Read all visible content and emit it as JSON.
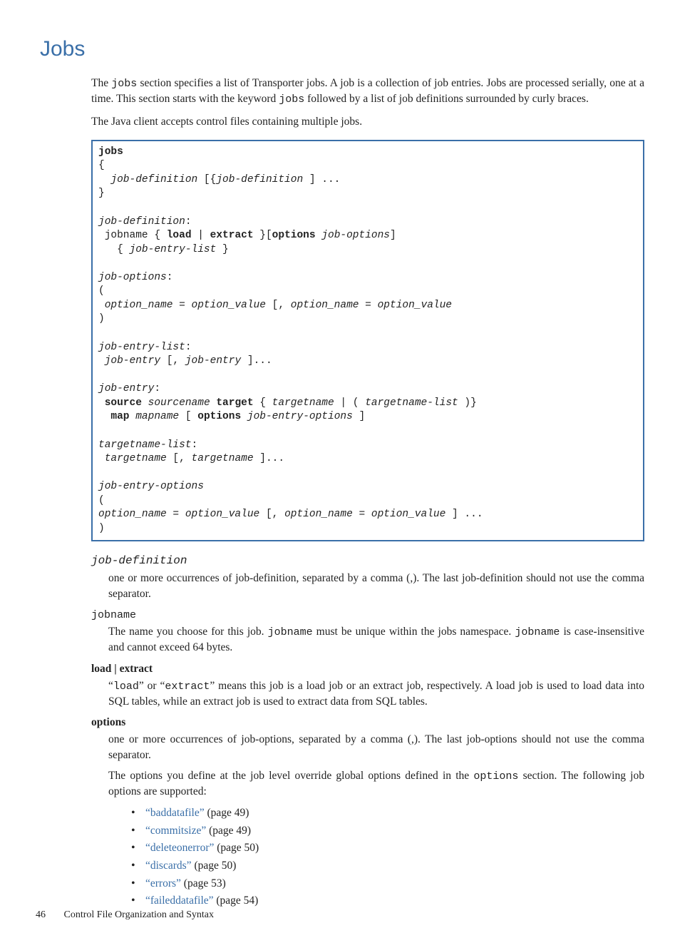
{
  "heading": "Jobs",
  "intro": {
    "p1a": "The ",
    "p1_code1": "jobs",
    "p1b": " section specifies a list of Transporter jobs. A job is a collection of job entries. Jobs are processed serially, one at a time. This section starts with the keyword ",
    "p1_code2": "jobs",
    "p1c": " followed by a list of job definitions surrounded by curly braces.",
    "p2": "The Java client accepts control files containing multiple jobs."
  },
  "syntax": {
    "l1": "jobs",
    "l2": "{",
    "l3a": "  ",
    "l3b": "job-definition",
    "l3c": " [{",
    "l3d": "job-definition",
    "l3e": " ] ...",
    "l4": "}",
    "blank1": " ",
    "l5": "job-definition",
    "l5b": ":",
    "l6a": " jobname { ",
    "l6b": "load",
    "l6c": " | ",
    "l6d": "extract",
    "l6e": " }[",
    "l6f": "options",
    "l6g": " ",
    "l6h": "job-options",
    "l6i": "]",
    "l7a": "   { ",
    "l7b": "job-entry-list",
    "l7c": " }",
    "blank2": " ",
    "l8": "job-options",
    "l8b": ":",
    "l9": "(",
    "l10a": " ",
    "l10b": "option_name = option_value",
    "l10c": " [, ",
    "l10d": "option_name = option_value",
    "l11": ")",
    "blank3": " ",
    "l12": "job-entry-list",
    "l12b": ":",
    "l13a": " ",
    "l13b": "job-entry",
    "l13c": " [, ",
    "l13d": "job-entry",
    "l13e": " ]...",
    "blank4": " ",
    "l14": "job-entry",
    "l14b": ":",
    "l15a": " ",
    "l15b": "source",
    "l15c": " ",
    "l15d": "sourcename",
    "l15e": " ",
    "l15f": "target",
    "l15g": " { ",
    "l15h": "targetname",
    "l15i": " | ( ",
    "l15j": "targetname-list",
    "l15k": " )}",
    "l16a": "  ",
    "l16b": "map",
    "l16c": " ",
    "l16d": "mapname",
    "l16e": " [ ",
    "l16f": "options",
    "l16g": " ",
    "l16h": "job-entry-options",
    "l16i": " ]",
    "blank5": " ",
    "l17": "targetname-list",
    "l17b": ":",
    "l18a": " ",
    "l18b": "targetname",
    "l18c": " [, ",
    "l18d": "targetname",
    "l18e": " ]...",
    "blank6": " ",
    "l19": "job-entry-options",
    "l20": "(",
    "l21a": "option_name = option_value",
    "l21b": " [, ",
    "l21c": "option_name = option_value",
    "l21d": " ] ...",
    "l22": ")"
  },
  "defs": {
    "t1": "job-definition",
    "d1a": "one or more occurrences of ",
    "d1b": "job-definition",
    "d1c": ", separated by a comma (,). The last ",
    "d1d": "job-definition",
    "d1e": " should not use the comma separator.",
    "t2": "jobname",
    "d2a": "The name you choose for this job. ",
    "d2b": "jobname",
    "d2c": " must be unique within the jobs namespace. ",
    "d2d": "jobname",
    "d2e": " is case-insensitive and cannot exceed 64 bytes.",
    "t3": "load | extract",
    "d3a": "“",
    "d3b": "load",
    "d3c": "” or “",
    "d3d": "extract",
    "d3e": "” means this job is a load job or an extract job, respectively. A load job is used to load data into SQL tables, while an extract job is used to extract data from SQL tables.",
    "t4": "options",
    "d4a": "one or more occurrences of ",
    "d4b": "job-options",
    "d4c": ", separated by a comma (,). The last ",
    "d4d": "job-options",
    "d4e": " should not use the comma separator.",
    "d4f": "The options you define at the job level override global options defined in the ",
    "d4g": "options",
    "d4h": " section. The following job options are supported:"
  },
  "option_links": [
    {
      "name": "“baddatafile”",
      "page": " (page 49)"
    },
    {
      "name": "“commitsize”",
      "page": " (page 49)"
    },
    {
      "name": "“deleteonerror”",
      "page": " (page 50)"
    },
    {
      "name": "“discards”",
      "page": " (page 50)"
    },
    {
      "name": "“errors”",
      "page": " (page 53)"
    },
    {
      "name": "“faileddatafile”",
      "page": " (page 54)"
    }
  ],
  "footer": {
    "page": "46",
    "title": "Control File Organization and Syntax"
  }
}
